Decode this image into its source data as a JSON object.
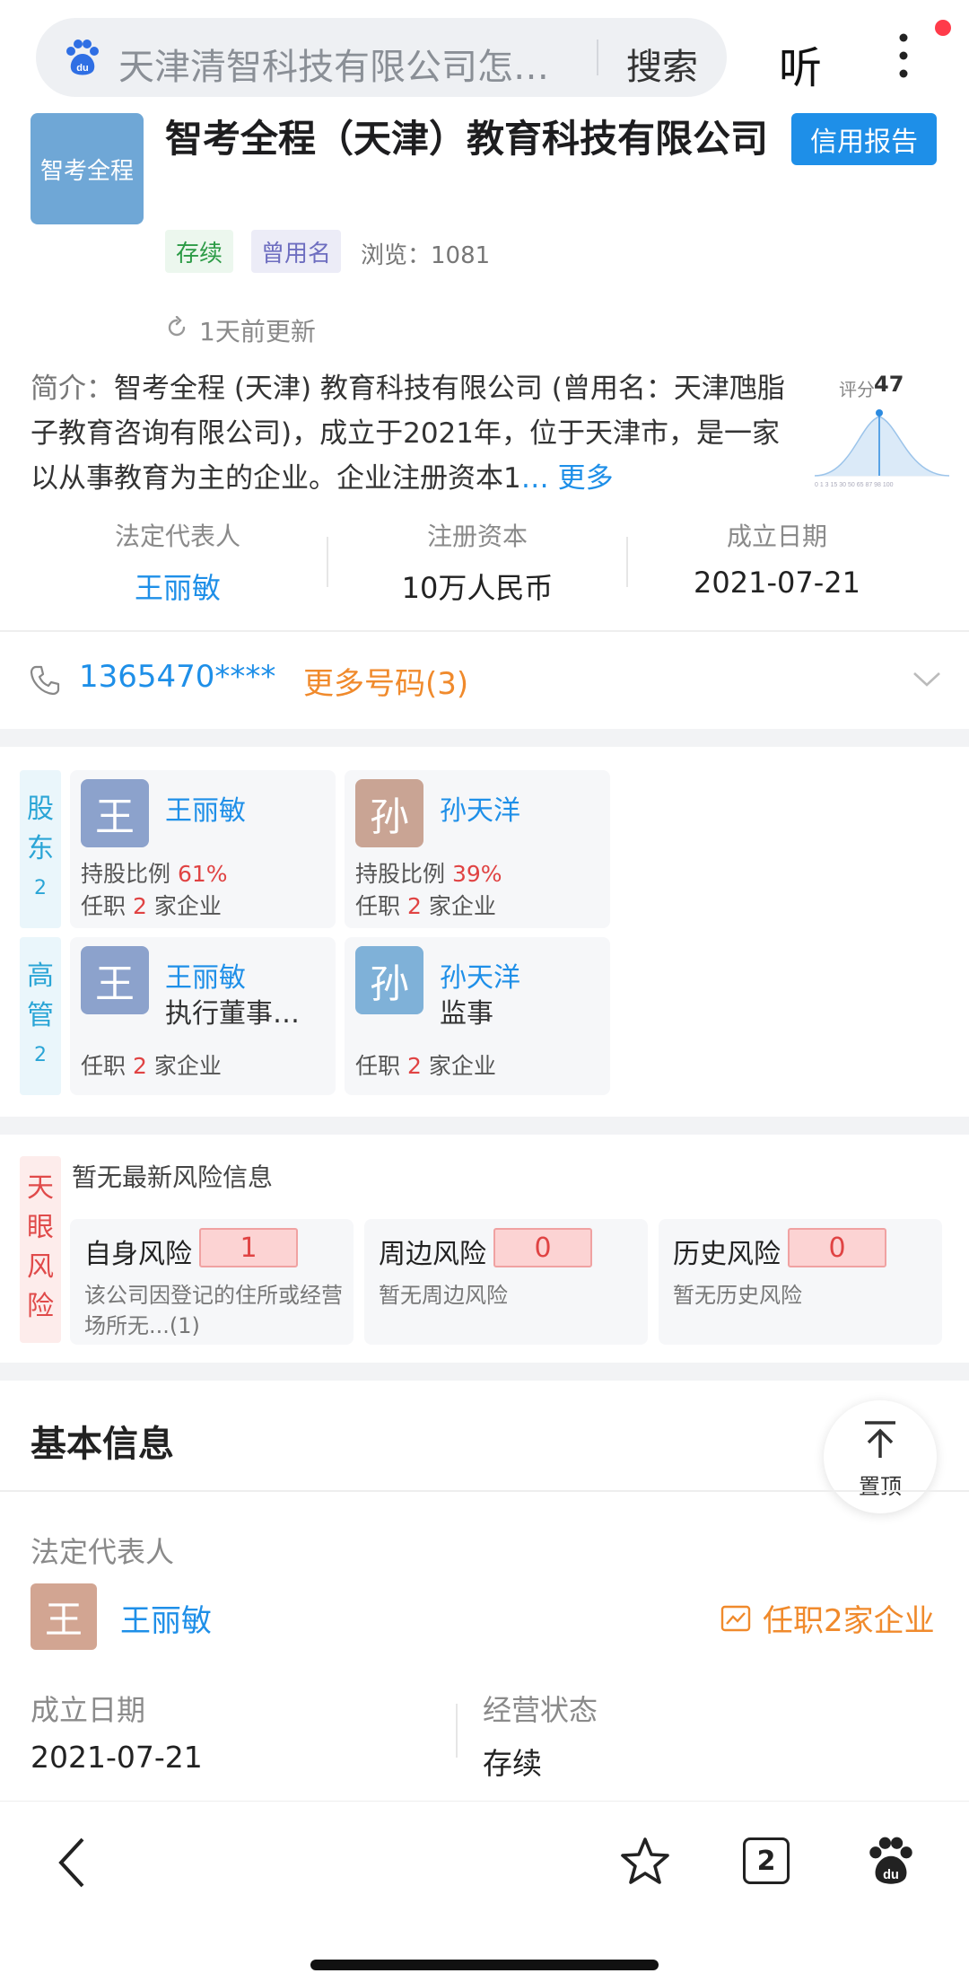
{
  "search": {
    "query": "天津清智科技有限公司怎…",
    "button": "搜索",
    "listen": "听"
  },
  "company": {
    "logo_text": "智考全程",
    "name": "智考全程（天津）教育科技有限公司",
    "credit_button": "信用报告",
    "tags": [
      "存续",
      "曾用名"
    ],
    "views": "浏览：1081",
    "updated": "1天前更新",
    "intro_label": "简介：",
    "intro_text": "智考全程 (天津) 教育科技有限公司 (曾用名：天津虺脂子教育咨询有限公司)，成立于2021年，位于天津市，是一家以从事教育为主的企业。企业注册资本1",
    "intro_more": "… 更多",
    "score_label": "评分",
    "score_value": 47
  },
  "key_info": [
    {
      "label": "法定代表人",
      "value": "王丽敏"
    },
    {
      "label": "注册资本",
      "value": "10万人民币"
    },
    {
      "label": "成立日期",
      "value": "2021-07-21"
    }
  ],
  "phone": {
    "number": "1365470****",
    "more": "更多号码(3)"
  },
  "shareholders": {
    "tab": [
      "股",
      "东"
    ],
    "count": "2",
    "items": [
      {
        "avatar": "王",
        "name": "王丽敏",
        "ratio_label": "持股比例",
        "ratio": "61%",
        "jobs_pre": "任职",
        "jobs_n": "2",
        "jobs_post": "家企业",
        "color": "#8ca2cc"
      },
      {
        "avatar": "孙",
        "name": "孙天洋",
        "ratio_label": "持股比例",
        "ratio": "39%",
        "jobs_pre": "任职",
        "jobs_n": "2",
        "jobs_post": "家企业",
        "color": "#c9a494"
      }
    ]
  },
  "management": {
    "tab": [
      "高",
      "管"
    ],
    "count": "2",
    "items": [
      {
        "avatar": "王",
        "name": "王丽敏",
        "role": "执行董事…",
        "jobs_pre": "任职",
        "jobs_n": "2",
        "jobs_post": "家企业",
        "color": "#8ca2cc"
      },
      {
        "avatar": "孙",
        "name": "孙天洋",
        "role": "监事",
        "jobs_pre": "任职",
        "jobs_n": "2",
        "jobs_post": "家企业",
        "color": "#7fb1d8"
      }
    ]
  },
  "risk": {
    "tab": [
      "天",
      "眼",
      "风",
      "险"
    ],
    "note": "暂无最新风险信息",
    "cards": [
      {
        "title": "自身风险",
        "count": "1",
        "desc": "该公司因登记的住所或经营场所无...(1)"
      },
      {
        "title": "周边风险",
        "count": "0",
        "desc": "暂无周边风险"
      },
      {
        "title": "历史风险",
        "count": "0",
        "desc": "暂无历史风险"
      }
    ]
  },
  "basic_info": {
    "title": "基本信息",
    "to_top": "置顶",
    "legal_rep_label": "法定代表人",
    "legal_rep_avatar": "王",
    "legal_rep_name": "王丽敏",
    "legal_rep_jobs": "任职2家企业",
    "founded_label": "成立日期",
    "founded_value": "2021-07-21",
    "status_label": "经营状态",
    "status_value": "存续"
  },
  "bottom_nav": {
    "tabs_count": "2"
  }
}
